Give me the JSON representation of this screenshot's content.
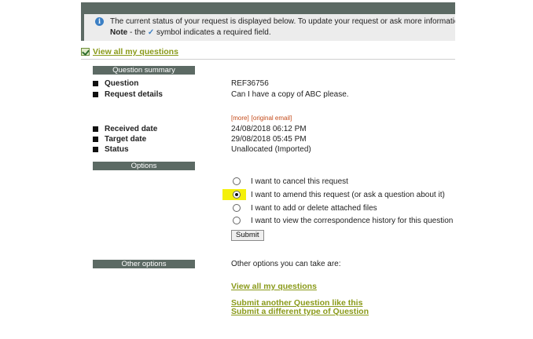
{
  "info": {
    "line1": "The current status of your request is displayed below. To update your request or ask more information abou",
    "note_label": "Note",
    "note_text_before": " - the ",
    "check_symbol": "✓",
    "note_text_after": " symbol indicates a required field."
  },
  "links": {
    "view_all_top": "View all my questions"
  },
  "summary": {
    "header": "Question summary",
    "question_label": "Question",
    "question_value": "REF36756",
    "details_label": "Request details",
    "details_value": "Can I have a copy of ABC please.",
    "more_link": "[more]",
    "original_email_link": "[original email]",
    "received_label": "Received date",
    "received_value": "24/08/2018 06:12 PM",
    "target_label": "Target date",
    "target_value": "29/08/2018 05:45 PM",
    "status_label": "Status",
    "status_value": "Unallocated (Imported)"
  },
  "options": {
    "header": "Options",
    "items": [
      {
        "label": "I want to cancel this request",
        "checked": false
      },
      {
        "label": "I want to amend this request (or ask a question about it)",
        "checked": true
      },
      {
        "label": "I want to add or delete attached files",
        "checked": false
      },
      {
        "label": "I want to view the correspondence history for this question",
        "checked": false
      }
    ],
    "submit_label": "Submit"
  },
  "other": {
    "header": "Other options",
    "intro": "Other options you can take are:",
    "view_all": "View all my questions",
    "submit_another": "Submit another Question like this",
    "submit_different": "Submit a different type of Question"
  },
  "colors": {
    "bar": "#5c6a64",
    "link": "#8a9a1a",
    "highlight": "#f4f00a",
    "small_link": "#c44b1a"
  }
}
